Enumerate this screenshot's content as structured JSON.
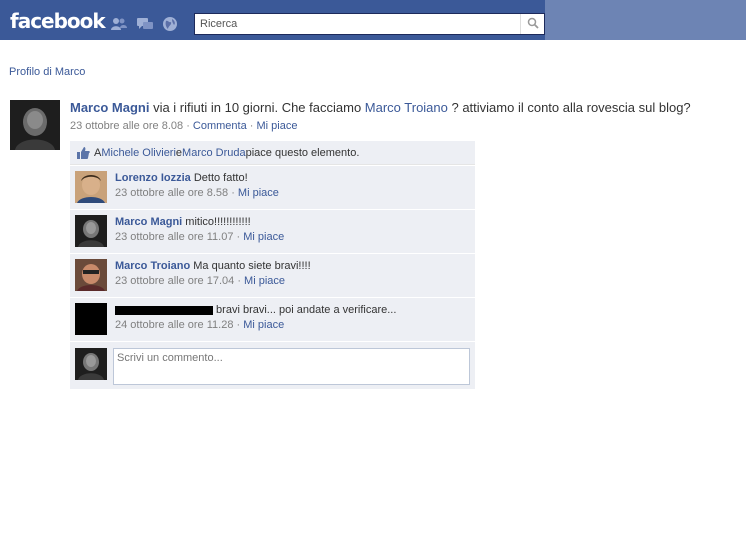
{
  "header": {
    "logo": "facebook",
    "search_placeholder": "Ricerca",
    "icons": [
      "friends-icon",
      "messages-icon",
      "notifications-icon",
      "search-icon"
    ],
    "colors": {
      "bar": "#3b5998",
      "bar_right": "#6d84b4",
      "link": "#3b5998"
    }
  },
  "breadcrumb": "Profilo di Marco",
  "story": {
    "author": "Marco Magni",
    "text_before": " via i rifiuti in 10 giorni. Che facciamo ",
    "mention": "Marco Troiano",
    "text_after": " ? attiviamo il conto alla rovescia sul blog?",
    "time": "23 ottobre alle ore 8.08",
    "sep1": " · ",
    "comment_link": "Commenta",
    "sep2": " · ",
    "like_link": "Mi piace"
  },
  "likes": {
    "prefix": "A ",
    "person1": "Michele Olivieri",
    "joiner": " e ",
    "person2": "Marco Druda",
    "suffix": " piace questo elemento."
  },
  "comments": [
    {
      "author": "Lorenzo Iozzia",
      "text": " Detto fatto!",
      "time": "23 ottobre alle ore 8.58",
      "sep": " · ",
      "like": "Mi piace"
    },
    {
      "author": "Marco Magni",
      "text": " mitico!!!!!!!!!!!!",
      "time": "23 ottobre alle ore 11.07",
      "sep": " · ",
      "like": "Mi piace"
    },
    {
      "author": "Marco Troiano",
      "text": " Ma quanto siete bravi!!!!",
      "time": "23 ottobre alle ore 17.04",
      "sep": " · ",
      "like": "Mi piace"
    },
    {
      "author": "",
      "text": " bravi bravi... poi andate a verificare...",
      "time": "24 ottobre alle ore 11.28",
      "sep": " · ",
      "like": "Mi piace"
    }
  ],
  "composer": {
    "placeholder": "Scrivi un commento..."
  }
}
